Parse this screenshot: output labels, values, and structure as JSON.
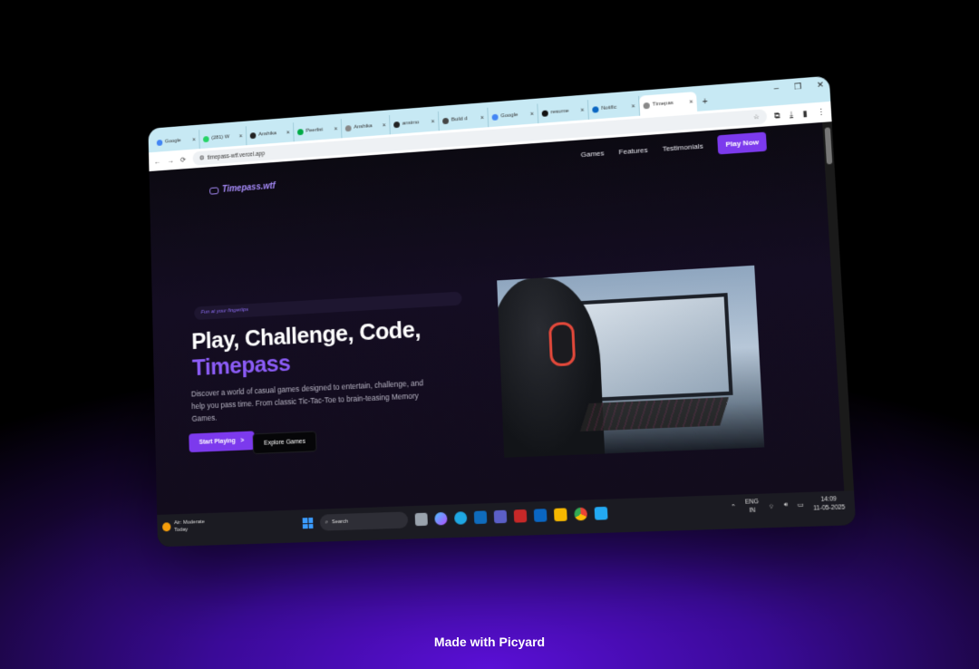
{
  "browser": {
    "tabs": [
      {
        "title": "Google",
        "icon": "google-icon",
        "color": "#4285f4"
      },
      {
        "title": "(281) W",
        "icon": "whatsapp-icon",
        "color": "#25d366"
      },
      {
        "title": "Anshika",
        "icon": "github-icon",
        "color": "#222222"
      },
      {
        "title": "Peerlist",
        "icon": "peerlist-icon",
        "color": "#00aa45"
      },
      {
        "title": "Anshika",
        "icon": "globe-icon",
        "color": "#888888"
      },
      {
        "title": "ansimo",
        "icon": "github-icon",
        "color": "#222222"
      },
      {
        "title": "Build d",
        "icon": "robot-icon",
        "color": "#444444"
      },
      {
        "title": "Google",
        "icon": "google-icon",
        "color": "#4285f4"
      },
      {
        "title": "resume",
        "icon": "notion-icon",
        "color": "#111111"
      },
      {
        "title": "Notific",
        "icon": "linkedin-icon",
        "color": "#0a66c2"
      },
      {
        "title": "Timepas",
        "icon": "globe-icon",
        "color": "#888888",
        "active": true
      }
    ],
    "new_tab": "+",
    "window_controls": {
      "minimize": "–",
      "maximize": "❐",
      "close": "✕"
    },
    "url": "timepass-wtf.vercel.app",
    "nav_back": "←",
    "nav_forward": "→",
    "reload": "⟳"
  },
  "site": {
    "logo": "Timepass.wtf",
    "nav": {
      "games": "Games",
      "features": "Features",
      "testimonials": "Testimonials",
      "cta": "Play Now"
    },
    "tagline": "Fun at your fingertips",
    "heading_line1": "Play, Challenge, Code,",
    "heading_line2": "Timepass",
    "description": "Discover a world of casual games designed to entertain, challenge, and help you pass time. From classic Tic-Tac-Toe to brain-teasing Memory Games.",
    "start_button": "Start Playing",
    "start_arrow": ">",
    "explore_button": "Explore Games"
  },
  "taskbar": {
    "weather_title": "Air: Moderate",
    "weather_sub": "Today",
    "search": "Search",
    "lang_top": "ENG",
    "lang_bottom": "IN",
    "time": "14:09",
    "date": "11-05-2025"
  },
  "footer": "Made with Picyard",
  "colors": {
    "accent": "#7c3aed",
    "accent_text": "#8b5cf6"
  }
}
